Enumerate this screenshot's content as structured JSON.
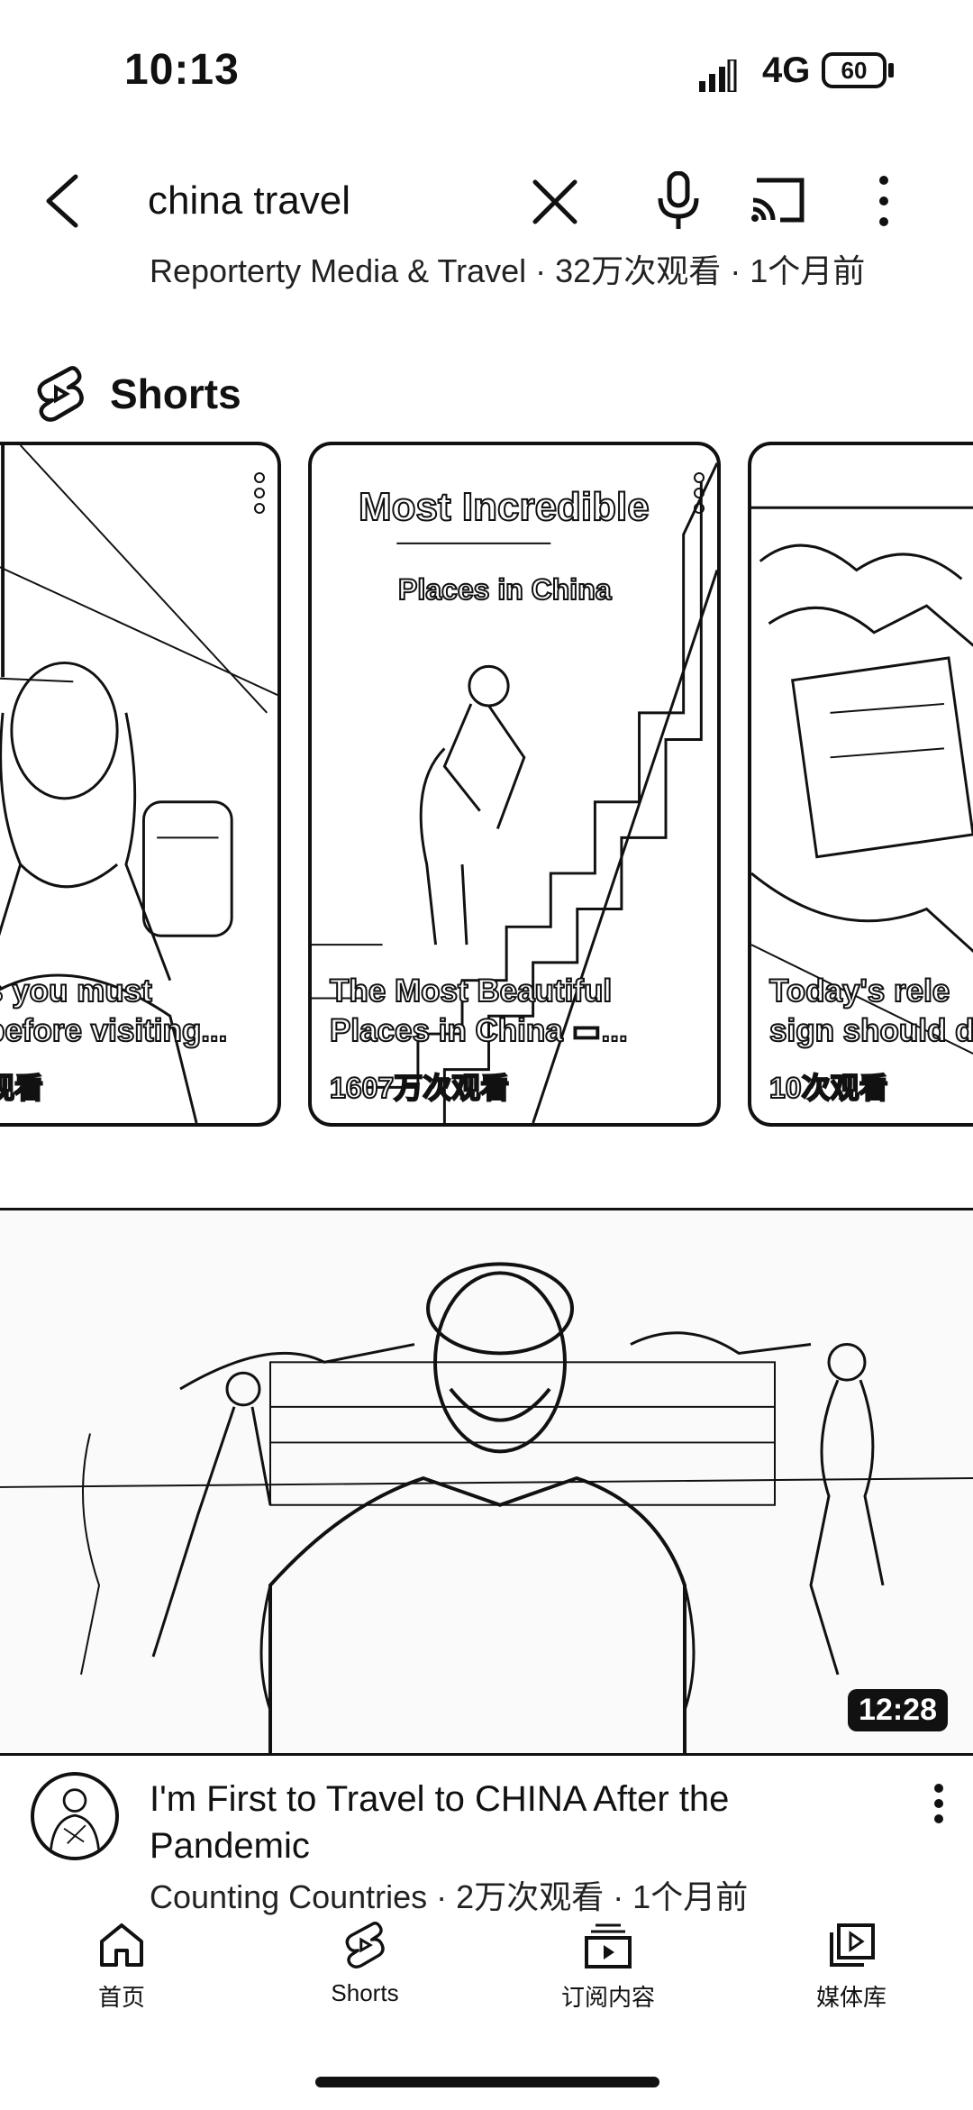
{
  "status_bar": {
    "time": "10:13",
    "network": "4G",
    "battery": "60"
  },
  "search": {
    "query": "china travel"
  },
  "previous_result": {
    "meta": "Reporterty Media & Travel · 32万次观看 · 1个月前"
  },
  "shorts_section": {
    "title": "Shorts",
    "items": [
      {
        "title_lines": [
          "s you must",
          "before visiting..."
        ],
        "views": "观看"
      },
      {
        "overlay_title": "Most Incredible",
        "overlay_sub": "Places in China",
        "title_lines": [
          "The Most Beautiful",
          "Places in China ▭..."
        ],
        "views": "1607万次观看"
      },
      {
        "title_lines": [
          "Today's rele",
          "sign should d"
        ],
        "views": "10次观看"
      }
    ]
  },
  "video": {
    "duration": "12:28",
    "title": "I'm First to Travel to CHINA After the Pandemic",
    "meta": "Counting Countries · 2万次观看 · 1个月前"
  },
  "bottom_nav": {
    "items": [
      {
        "label": "首页",
        "icon": "home-icon"
      },
      {
        "label": "Shorts",
        "icon": "shorts-icon"
      },
      {
        "label": "订阅内容",
        "icon": "subscriptions-icon"
      },
      {
        "label": "媒体库",
        "icon": "library-icon"
      }
    ]
  }
}
